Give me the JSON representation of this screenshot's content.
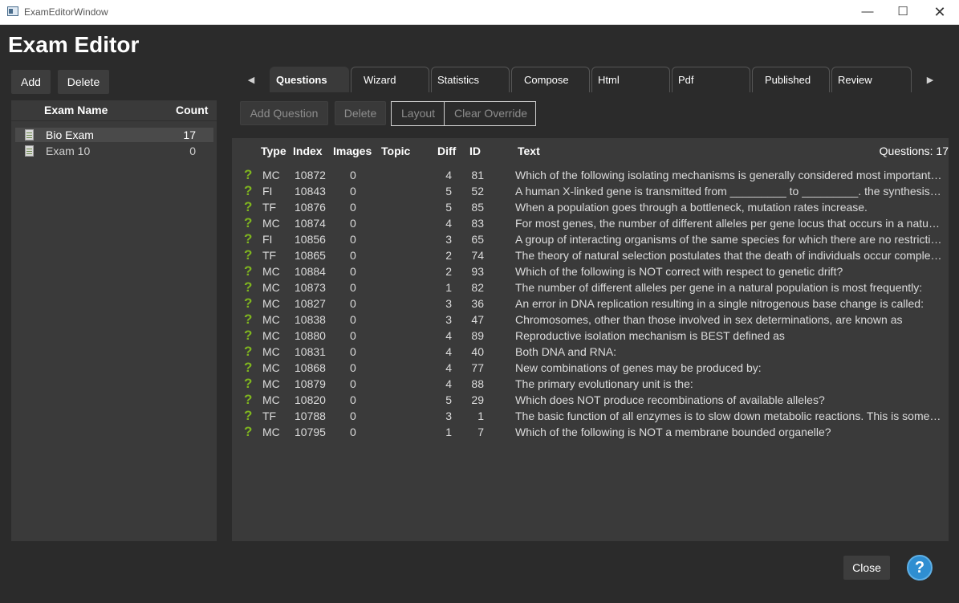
{
  "window": {
    "title": "ExamEditorWindow",
    "minimize": "—",
    "maximize": "☐",
    "close": "✕"
  },
  "app_title": "Exam Editor",
  "left_toolbar": {
    "add": "Add",
    "delete": "Delete"
  },
  "exam_list": {
    "headers": {
      "name": "Exam Name",
      "count": "Count"
    },
    "items": [
      {
        "name": "Bio Exam",
        "count": "17"
      },
      {
        "name": "Exam 10",
        "count": "0"
      }
    ]
  },
  "tabs": [
    "Questions",
    "Wizard",
    "Statistics",
    "Compose",
    "Html",
    "Pdf",
    "Published",
    "Review"
  ],
  "tab_arrows": {
    "left": "◀",
    "right": "▶"
  },
  "question_toolbar": {
    "add_question": "Add Question",
    "delete": "Delete",
    "layout": "Layout",
    "clear_override": "Clear Override"
  },
  "questions": {
    "headers": {
      "type": "Type",
      "index": "Index",
      "images": "Images",
      "topic": "Topic",
      "diff": "Diff",
      "id": "ID",
      "text": "Text"
    },
    "count_label": "Questions: 17",
    "icon": "?",
    "rows": [
      {
        "type": "MC",
        "index": "10872",
        "images": "0",
        "diff": "4",
        "id": "81",
        "text": "Which of the following isolating mechanisms is generally  considered most important in speciation?"
      },
      {
        "type": "FI",
        "index": "10843",
        "images": "0",
        "diff": "5",
        "id": "52",
        "text": "A human X-linked gene is transmitted from _________ to _________.   the synthesis of proteins"
      },
      {
        "type": "TF",
        "index": "10876",
        "images": "0",
        "diff": "5",
        "id": "85",
        "text": "When a population goes through a bottleneck, mutation rates  increase."
      },
      {
        "type": "MC",
        "index": "10874",
        "images": "0",
        "diff": "4",
        "id": "83",
        "text": "For most genes, the number of different alleles per gene  locus that occurs in a natural population is"
      },
      {
        "type": "FI",
        "index": "10856",
        "images": "0",
        "diff": "3",
        "id": "65",
        "text": "A group of interacting organisms of the same species for  which there are no restrictions on mating"
      },
      {
        "type": "TF",
        "index": "10865",
        "images": "0",
        "diff": "2",
        "id": "74",
        "text": "The theory of natural selection postulates that  the death of  individuals occur completely at random"
      },
      {
        "type": "MC",
        "index": "10884",
        "images": "0",
        "diff": "2",
        "id": "93",
        "text": "Which of the following is NOT correct with respect to genetic  drift?"
      },
      {
        "type": "MC",
        "index": "10873",
        "images": "0",
        "diff": "1",
        "id": "82",
        "text": "The number of different alleles per gene in a  natural  population is most frequently:"
      },
      {
        "type": "MC",
        "index": "10827",
        "images": "0",
        "diff": "3",
        "id": "36",
        "text": "An error in DNA replication resulting in a single nitrogenous  base change is called:"
      },
      {
        "type": "MC",
        "index": "10838",
        "images": "0",
        "diff": "3",
        "id": "47",
        "text": "Chromosomes, other than those involved in sex determinations,  are known as"
      },
      {
        "type": "MC",
        "index": "10880",
        "images": "0",
        "diff": "4",
        "id": "89",
        "text": "Reproductive isolation mechanism is BEST defined as"
      },
      {
        "type": "MC",
        "index": "10831",
        "images": "0",
        "diff": "4",
        "id": "40",
        "text": "Both DNA and RNA:"
      },
      {
        "type": "MC",
        "index": "10868",
        "images": "0",
        "diff": "4",
        "id": "77",
        "text": "New combinations of genes may be produced by:"
      },
      {
        "type": "MC",
        "index": "10879",
        "images": "0",
        "diff": "4",
        "id": "88",
        "text": "The primary evolutionary unit is the:"
      },
      {
        "type": "MC",
        "index": "10820",
        "images": "0",
        "diff": "5",
        "id": "29",
        "text": "Which does NOT produce recombinations of available alleles?"
      },
      {
        "type": "TF",
        "index": "10788",
        "images": "0",
        "diff": "3",
        "id": "1",
        "text": "The basic function of all enzymes is to slow down metabolic reactions.  This is something else"
      },
      {
        "type": "MC",
        "index": "10795",
        "images": "0",
        "diff": "1",
        "id": "7",
        "text": "Which of the following is NOT a membrane bounded organelle?"
      }
    ]
  },
  "footer": {
    "close": "Close",
    "help": "?"
  }
}
